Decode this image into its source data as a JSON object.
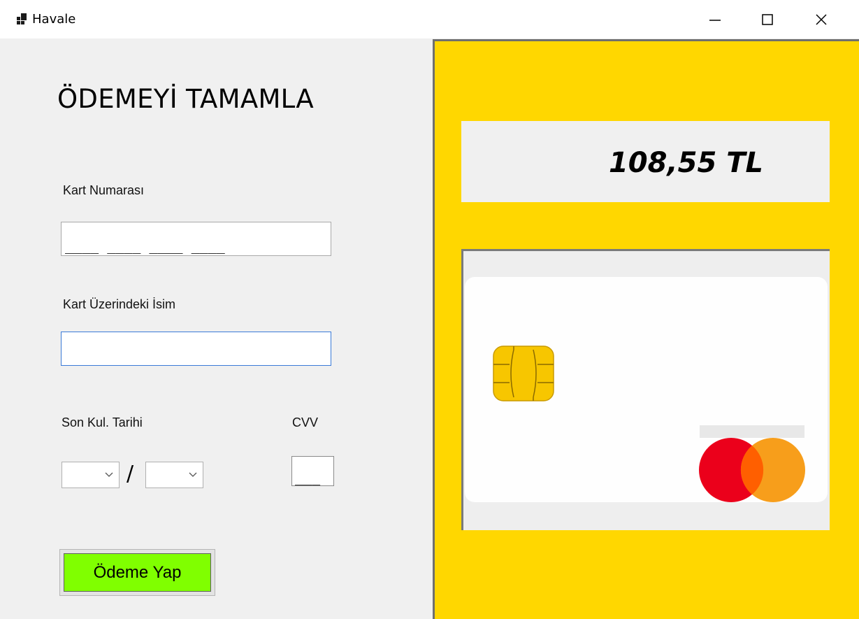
{
  "window": {
    "title": "Havale",
    "minimize_icon": "minimize-icon",
    "maximize_icon": "maximize-icon",
    "close_icon": "close-icon"
  },
  "form": {
    "heading": "ÖDEMEYİ TAMAMLA",
    "card_number_label": "Kart Numarası",
    "card_number_mask": "____ ____ ____ ____",
    "card_name_label": "Kart Üzerindeki İsim",
    "card_name_value": "",
    "expiry_label": "Son Kul. Tarihi",
    "expiry_separator": "/",
    "expiry_month": "",
    "expiry_year": "",
    "cvv_label": "CVV",
    "cvv_mask": "___",
    "pay_button": "Ödeme Yap"
  },
  "summary": {
    "amount": "108,55 TL"
  },
  "card_image": {
    "chip_icon": "card-chip-icon",
    "brand_logo": "mastercard-logo",
    "colors": {
      "panel": "#ffd700",
      "pay_button": "#80ff00",
      "logo_red": "#eb001b",
      "logo_orange": "#f79e1b",
      "logo_overlap": "#ff5f00"
    }
  }
}
